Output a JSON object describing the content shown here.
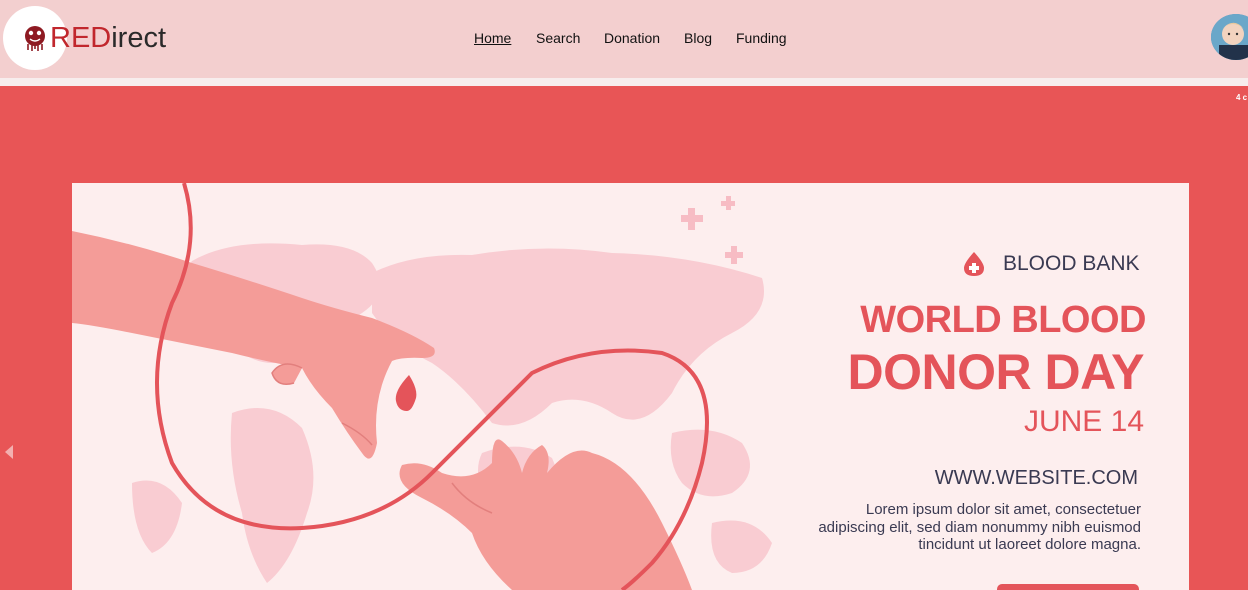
{
  "brand": {
    "logo_red": "RED",
    "logo_rest": "irect"
  },
  "nav": {
    "items": [
      "Home",
      "Search",
      "Donation",
      "Blog",
      "Funding"
    ],
    "active": "Home"
  },
  "slider": {
    "counter": "4 c"
  },
  "banner": {
    "badge": "BLOOD BANK",
    "title_line1": "WORLD BLOOD",
    "title_line2": "DONOR DAY",
    "date": "JUNE 14",
    "website": "WWW.WEBSITE.COM",
    "body": "Lorem ipsum dolor sit amet, consectetuer adipiscing elit, sed diam nonummy nibh euismod tincidunt ut laoreet dolore magna."
  },
  "colors": {
    "header_bg": "#f3cfcf",
    "page_red": "#e85556",
    "banner_bg": "#fdeeee",
    "accent": "#e4545a",
    "dark_text": "#3a3a52",
    "brand_red": "#c1272d"
  },
  "icons": {
    "logo": "heart-tree-emblem",
    "badge": "blood-drop-cross-icon",
    "prev": "caret-left-icon"
  }
}
